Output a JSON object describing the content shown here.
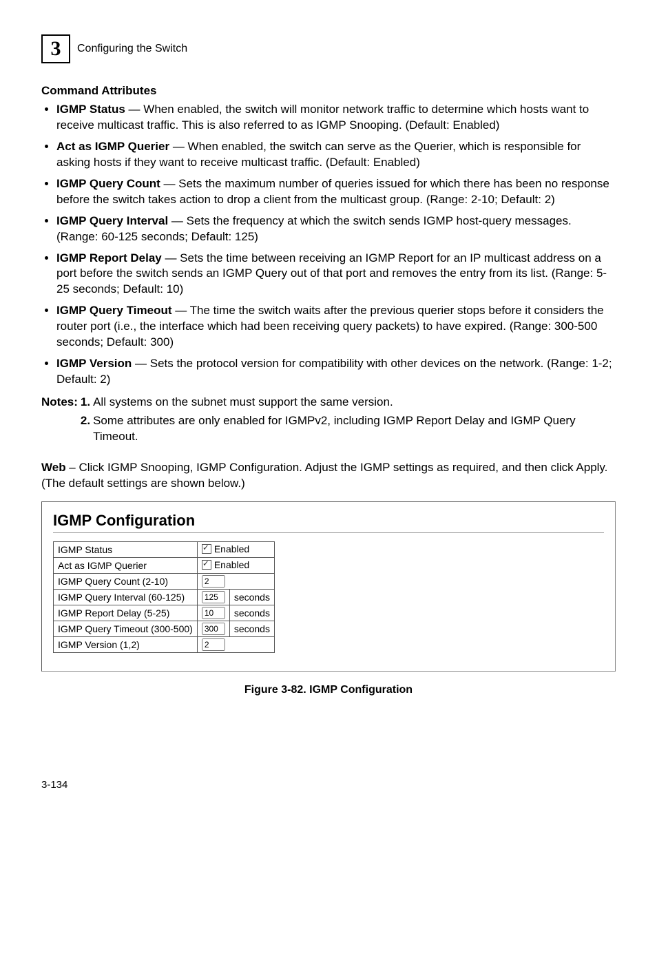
{
  "header": {
    "chapter": "3",
    "title": "Configuring the Switch"
  },
  "sectionTitle": "Command Attributes",
  "attrs": [
    {
      "name": "IGMP Status",
      "desc": " — When enabled, the switch will monitor network traffic to determine which hosts want to receive multicast traffic. This is also referred to as IGMP Snooping. (Default: Enabled)"
    },
    {
      "name": "Act as IGMP Querier",
      "desc": " — When enabled, the switch can serve as the Querier, which is responsible for asking hosts if they want to receive multicast traffic. (Default: Enabled)"
    },
    {
      "name": "IGMP Query Count",
      "desc": " — Sets the maximum number of queries issued for which there has been no response before the switch takes action to drop a client from the multicast group. (Range: 2-10; Default: 2)"
    },
    {
      "name": "IGMP Query Interval",
      "desc": " — Sets the frequency at which the switch sends IGMP host-query messages. (Range: 60-125 seconds; Default: 125)"
    },
    {
      "name": "IGMP Report Delay",
      "desc": " — Sets the time between receiving an IGMP Report for an IP multicast address on a port before the switch sends an IGMP Query out of that port and removes the entry from its list. (Range: 5-25 seconds; Default: 10)"
    },
    {
      "name": " IGMP Query Timeout",
      "desc": " — The time the switch waits after the previous querier stops before it considers the router port (i.e., the interface which had been receiving query packets) to have expired. (Range: 300-500 seconds; Default: 300)"
    },
    {
      "name": "IGMP Version",
      "desc": " — Sets the protocol version for compatibility with other devices on the network. (Range: 1-2; Default: 2)"
    }
  ],
  "notesLabel": "Notes:",
  "notes": [
    {
      "num": "1.",
      "text": "All systems on the subnet must support the same version."
    },
    {
      "num": "2.",
      "text": "Some attributes are only enabled for IGMPv2, including IGMP Report Delay and IGMP Query Timeout."
    }
  ],
  "webLabel": "Web",
  "webText": " – Click IGMP Snooping, IGMP Configuration. Adjust the IGMP settings as required, and then click Apply. (The default settings are shown below.)",
  "panel": {
    "title": "IGMP Configuration",
    "rows": {
      "status": {
        "label": "IGMP Status",
        "value": "Enabled"
      },
      "querier": {
        "label": "Act as IGMP Querier",
        "value": "Enabled"
      },
      "count": {
        "label": "IGMP Query Count (2-10)",
        "value": "2"
      },
      "interval": {
        "label": "IGMP Query Interval (60-125)",
        "value": "125",
        "unit": "seconds"
      },
      "delay": {
        "label": "IGMP Report Delay (5-25)",
        "value": "10",
        "unit": "seconds"
      },
      "timeout": {
        "label": "IGMP Query Timeout (300-500)",
        "value": "300",
        "unit": "seconds"
      },
      "version": {
        "label": "IGMP Version (1,2)",
        "value": "2"
      }
    }
  },
  "figureCaption": "Figure 3-82.  IGMP Configuration",
  "pageNumber": "3-134"
}
